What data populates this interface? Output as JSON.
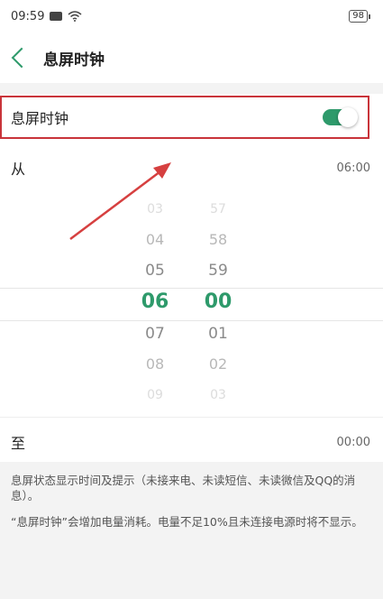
{
  "status_bar": {
    "time": "09:59",
    "battery": "98"
  },
  "header": {
    "title": "息屏时钟"
  },
  "toggle_row": {
    "label": "息屏时钟",
    "enabled": true,
    "accent": "#2e9a6b"
  },
  "from_row": {
    "label": "从",
    "value": "06:00"
  },
  "picker": {
    "hours": [
      "03",
      "04",
      "05",
      "06",
      "07",
      "08",
      "09"
    ],
    "minutes": [
      "57",
      "58",
      "59",
      "00",
      "01",
      "02",
      "03"
    ],
    "selected_hour": "06",
    "selected_minute": "00"
  },
  "to_row": {
    "label": "至",
    "value": "00:00"
  },
  "footer": {
    "note1": "息屏状态显示时间及提示（未接来电、未读短信、未读微信及QQ的消息）。",
    "note2": "“息屏时钟”会增加电量消耗。电量不足10%且未连接电源时将不显示。"
  },
  "highlight_color": "#c9343a"
}
